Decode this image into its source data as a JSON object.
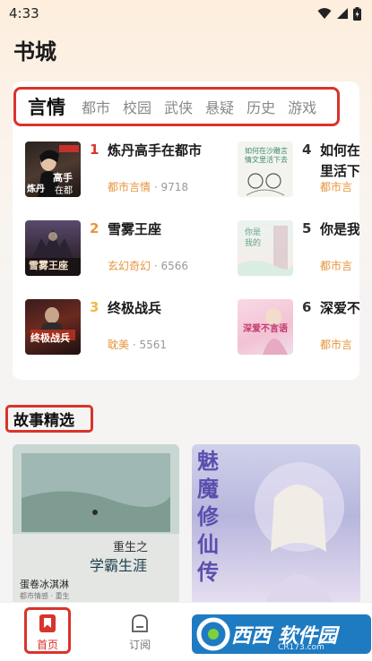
{
  "status_bar": {
    "time": "4:33"
  },
  "page": {
    "title": "书城"
  },
  "categories": [
    {
      "label": "言情",
      "active": true
    },
    {
      "label": "都市"
    },
    {
      "label": "校园"
    },
    {
      "label": "武侠"
    },
    {
      "label": "悬疑"
    },
    {
      "label": "历史"
    },
    {
      "label": "游戏"
    }
  ],
  "ranking": [
    {
      "rank": "1",
      "title": "炼丹高手在都市",
      "genre": "都市言情",
      "count": " · 9718"
    },
    {
      "rank": "2",
      "title": "雪雾王座",
      "genre": "玄幻奇幻",
      "count": " · 6566"
    },
    {
      "rank": "3",
      "title": "终极战兵",
      "genre": "耽美",
      "count": " · 5561"
    },
    {
      "rank": "4",
      "title": "如何在",
      "title2": "里活下",
      "genre": "都市言"
    },
    {
      "rank": "5",
      "title": "你是我",
      "genre": "都市言"
    },
    {
      "rank": "6",
      "title": "深爱不",
      "genre": "都市言"
    }
  ],
  "covers": {
    "c1": {
      "line1": "高手",
      "line2": "在都市",
      "badge": "炼丹"
    },
    "c2": {
      "text": "雪雾王座"
    },
    "c3": {
      "text": "终极战兵"
    },
    "c4": {
      "text": "如何在沙雕言情文里活下去"
    },
    "c5": {
      "text": "你是我的"
    },
    "c6": {
      "text": "深爱不言语"
    }
  },
  "section": {
    "title": "故事精选"
  },
  "stories": [
    {
      "title_line1": "重生之",
      "title_line2": "学霸生涯",
      "author": "蛋卷冰淇淋",
      "sub": "都市情感 · 重生"
    },
    {
      "title": "魅魔修仙传"
    }
  ],
  "tabs": [
    {
      "label": "首页",
      "active": true
    },
    {
      "label": "订阅"
    }
  ],
  "watermark": {
    "text1": "西西",
    "text2": "软件园",
    "url": "CR173.com"
  },
  "colors": {
    "accent": "#d9342b",
    "genre": "#e6943a",
    "rank1": "#d9342b",
    "rank2": "#e6943a",
    "rank3": "#f0b94a"
  }
}
